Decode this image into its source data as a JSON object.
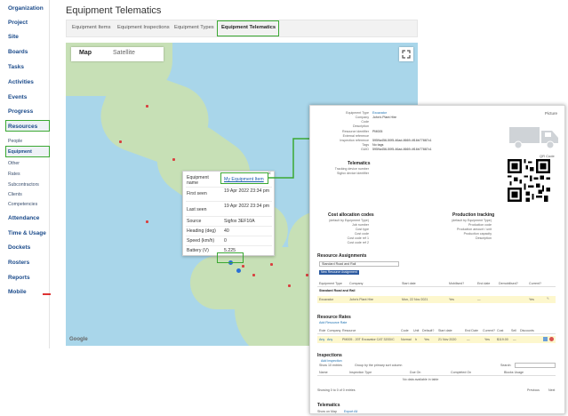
{
  "sidebar": {
    "items": [
      "Organization",
      "Project",
      "Site",
      "Boards",
      "Tasks",
      "Activities",
      "Events",
      "Progress",
      "Resources"
    ],
    "sub_items": [
      "People",
      "Equipment",
      "Other",
      "Rates",
      "Subcontractors",
      "Clients",
      "Competencies"
    ],
    "lower_items": [
      "Attendance",
      "Time & Usage",
      "Dockets",
      "Rosters",
      "Reports",
      "Mobile"
    ]
  },
  "page": {
    "title": "Equipment Telematics",
    "tabs": [
      "Equipment Items",
      "Equipment Inspections",
      "Equipment Types",
      "Equipment Telematics"
    ]
  },
  "map": {
    "type_map": "Map",
    "type_satellite": "Satellite",
    "google": "Google"
  },
  "infowindow": {
    "close": "×",
    "rows": [
      {
        "label": "Equipment name",
        "value": "My Equipment Item"
      },
      {
        "label": "First seen",
        "value": "19 Apr 2022 23:34 pm"
      },
      {
        "label": "Last seen",
        "value": "19 Apr 2022 23:34 pm"
      },
      {
        "label": "Source",
        "value": "Sigfox 3EF10A"
      },
      {
        "label": "Heading (deg)",
        "value": "40"
      },
      {
        "label": "Speed (km/h)",
        "value": "0"
      },
      {
        "label": "Battery (V)",
        "value": "5.225"
      }
    ]
  },
  "card": {
    "fields": [
      {
        "label": "Equipment Type",
        "value": "Excavator"
      },
      {
        "label": "Company",
        "value": "John's Plant Hire"
      },
      {
        "label": "Code",
        "value": ""
      },
      {
        "label": "Description",
        "value": ""
      },
      {
        "label": "Resource identifier",
        "value": "PM005"
      },
      {
        "label": "External reference",
        "value": ""
      },
      {
        "label": "Inspection reference",
        "value": "5959a456-50f5-46ad-8669-4f16b77887c1"
      },
      {
        "label": "Tags",
        "value": "No tags"
      },
      {
        "label": "GUID",
        "value": "5959a456-50f5-46ad-8669-4f16b77887c1"
      }
    ],
    "picture": "Picture",
    "qr": "QR Code",
    "telematics": "Telematics",
    "telematics_fields": [
      "Tracking device number",
      "Sigfox device identifier"
    ],
    "cost_title": "Cost allocation codes",
    "cost_fields": [
      "(default by Equipment Type)",
      "Job number",
      "Cost type",
      "Cost code",
      "Cost code ref 1",
      "Cost code ref 2"
    ],
    "prod_title": "Production tracking",
    "prod_fields": [
      "(default by Equipment Type)",
      "Production code",
      "Production amount / unit",
      "Production capacity",
      "Description"
    ],
    "res_assign_title": "Resource Assignments",
    "res_assign_select": "Standard Road and Rail",
    "new_assign_btn": "New Resource Assignment",
    "res_assign_headers": [
      "Equipment Type",
      "Company",
      "Start date",
      "Mobilised?",
      "End date",
      "Demobilised?",
      "Current?"
    ],
    "res_group": "Standard Road and Rail",
    "res_row": [
      "Excavator",
      "John's Plant Hire",
      "Mon, 22 Nov 2021",
      "Yes",
      "—",
      "Yes"
    ],
    "rates_title": "Resource Rates",
    "add_rate": "Add Resource Rate",
    "rates_headers": [
      "Role",
      "Company",
      "Resource",
      "Code",
      "Unit",
      "Default?",
      "Start date",
      "End Date",
      "Current?",
      "Cost",
      "Sell",
      "Discounts"
    ],
    "rates_row": [
      "Any",
      "Any",
      "PM005 - 20T Excavator CAT 320D/C",
      "Normal",
      "h",
      "Yes",
      "21 Nov 2020",
      "—",
      "Yes",
      "$119.00",
      "—"
    ],
    "inspections_title": "Inspections",
    "add_inspection": "Add inspection",
    "show_entries": "Show 10 entries",
    "group_by": "Group by the primary sort column",
    "search": "Search:",
    "insp_headers": [
      "Name",
      "Inspection Type",
      "Due On",
      "Completed On",
      "Blocks Usage"
    ],
    "no_data": "No data available in table",
    "showing": "Showing 0 to 0 of 0 entries",
    "prev": "Previous",
    "next": "Next",
    "telematics_bottom": "Telematics",
    "show_on_map": "Show on Map",
    "export": "Export All"
  },
  "colors": {
    "highlight": "#3aa832",
    "link": "#1a5cb0",
    "nav": "#1a4a8a"
  }
}
